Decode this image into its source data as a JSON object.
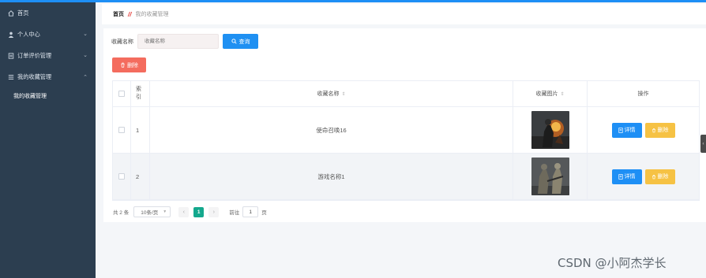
{
  "sidebar": {
    "items": [
      {
        "label": "首页",
        "icon": "home-icon"
      },
      {
        "label": "个人中心",
        "icon": "user-icon",
        "expand": "chevron-down"
      },
      {
        "label": "订单评价管理",
        "icon": "list-icon",
        "expand": "chevron-down"
      },
      {
        "label": "我的收藏管理",
        "icon": "menu-icon",
        "expand": "chevron-up"
      }
    ],
    "sub_items": [
      {
        "label": "我的收藏管理"
      }
    ]
  },
  "breadcrumb": {
    "home": "首页",
    "separator": "//",
    "current": "我的收藏管理"
  },
  "search": {
    "label": "收藏名称",
    "placeholder": "收藏名称",
    "button": "查询"
  },
  "toolbar": {
    "delete_label": "删除"
  },
  "table": {
    "headers": {
      "index": "索引",
      "name": "收藏名称",
      "image": "收藏图片",
      "ops": "操作"
    },
    "rows": [
      {
        "index": "1",
        "name": "使命召唤16",
        "image": "soldier-fire-thumbnail"
      },
      {
        "index": "2",
        "name": "游戏名称1",
        "image": "soldier-armor-thumbnail"
      }
    ],
    "detail_label": "详情",
    "delete_label": "删除"
  },
  "pagination": {
    "total": "共 2 条",
    "page_size": "10条/页",
    "current_page": "1",
    "goto_label": "前往",
    "goto_value": "1",
    "page_suffix": "页"
  },
  "watermark": "CSDN @小阿杰学长",
  "colors": {
    "sidebar": "#2c3e50",
    "primary": "#1e8ff5",
    "danger": "#f46c5e",
    "warning": "#f6c244",
    "page_active": "#14a88d"
  }
}
